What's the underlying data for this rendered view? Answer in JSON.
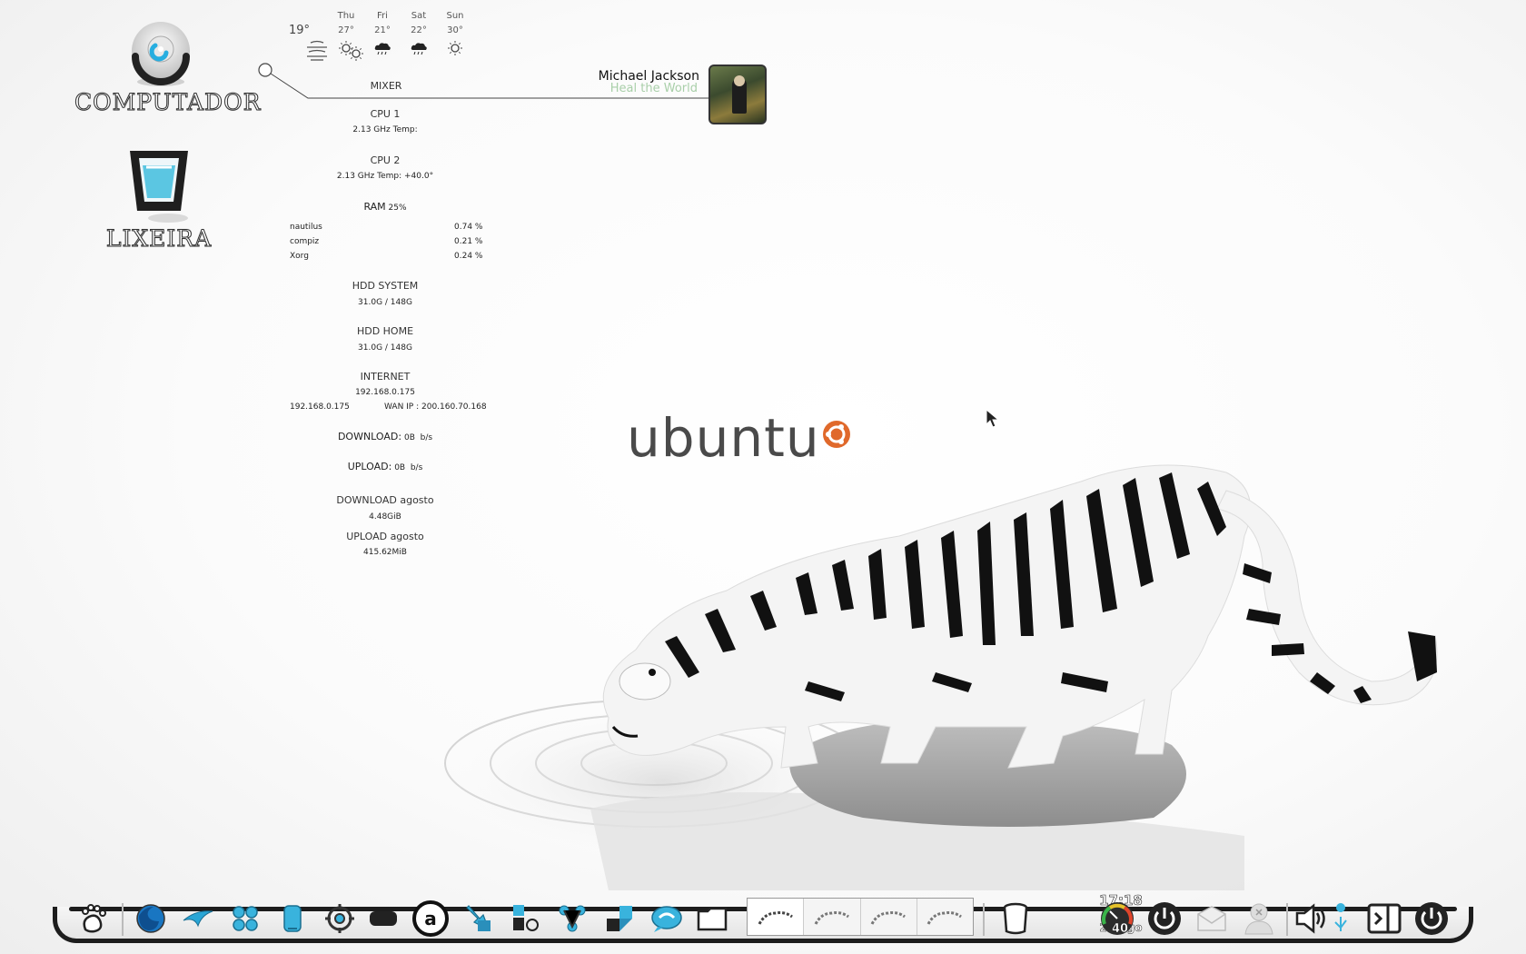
{
  "desktop": {
    "computer_label": "COMPUTADOR",
    "trash_label": "LIXEIRA"
  },
  "weather": {
    "current_temp": "19°",
    "forecast": [
      {
        "day": "Thu",
        "temp": "27°",
        "icon": "sun-icon"
      },
      {
        "day": "Fri",
        "temp": "21°",
        "icon": "sun-icon"
      },
      {
        "day": "Sat",
        "temp": "22°",
        "icon": "rain-cloud-icon"
      },
      {
        "day": "Sun",
        "temp": "30°",
        "icon": "rain-cloud-icon"
      },
      {
        "day": "",
        "temp": "",
        "icon": "sun-icon"
      }
    ]
  },
  "music": {
    "artist": "Michael Jackson",
    "title": "Heal the World",
    "mixer_label": "MIXER"
  },
  "monitor": {
    "cpu1": {
      "label": "CPU 1",
      "info": "2.13 GHz Temp:"
    },
    "cpu2": {
      "label": "CPU 2",
      "info": "2.13 GHz Temp: +40.0°"
    },
    "ram": {
      "label": "RAM",
      "value": "25%"
    },
    "processes": [
      {
        "name": "nautilus",
        "usage": "0.74 %"
      },
      {
        "name": "compiz",
        "usage": "0.21 %"
      },
      {
        "name": "Xorg",
        "usage": "0.24 %"
      }
    ],
    "hdd_system": {
      "label": "HDD SYSTEM",
      "value": "31.0G / 148G"
    },
    "hdd_home": {
      "label": "HDD HOME",
      "value": "31.0G / 148G"
    },
    "internet": {
      "label": "INTERNET",
      "local_ip": "192.168.0.175",
      "lan_ip": "192.168.0.175",
      "wan_ip": "WAN IP : 200.160.70.168"
    },
    "download": {
      "label": "DOWNLOAD:",
      "value": "0B",
      "unit": "b/s"
    },
    "upload": {
      "label": "UPLOAD:",
      "value": "0B",
      "unit": "b/s"
    },
    "download_month": {
      "label": "DOWNLOAD agosto",
      "value": "4.48GiB"
    },
    "upload_month": {
      "label": "UPLOAD agosto",
      "value": "415.62MiB"
    }
  },
  "wallpaper": {
    "logo_text": "ubuntu",
    "accent": "#e0692b"
  },
  "dock": {
    "clock": {
      "time": "17:18",
      "day": "Qua",
      "date": "24 Ago"
    },
    "gauge_value": "40",
    "workspaces": 4,
    "items": [
      "gnome-foot-icon",
      "firefox-icon",
      "email-swoosh-icon",
      "apps-grid-icon",
      "phone-icon",
      "settings-target-icon",
      "drive-icon",
      "amazon-icon",
      "download-icon",
      "shapes-icon",
      "network-icon",
      "puzzle-icon",
      "chat-icon",
      "folder-icon"
    ],
    "tray": [
      "trash-can-icon",
      "clock-icon",
      "gauge-icon",
      "power-icon",
      "mail-icon",
      "user-icon",
      "volume-icon",
      "bluetooth-icon",
      "window-switch-icon",
      "shutdown-icon"
    ]
  }
}
